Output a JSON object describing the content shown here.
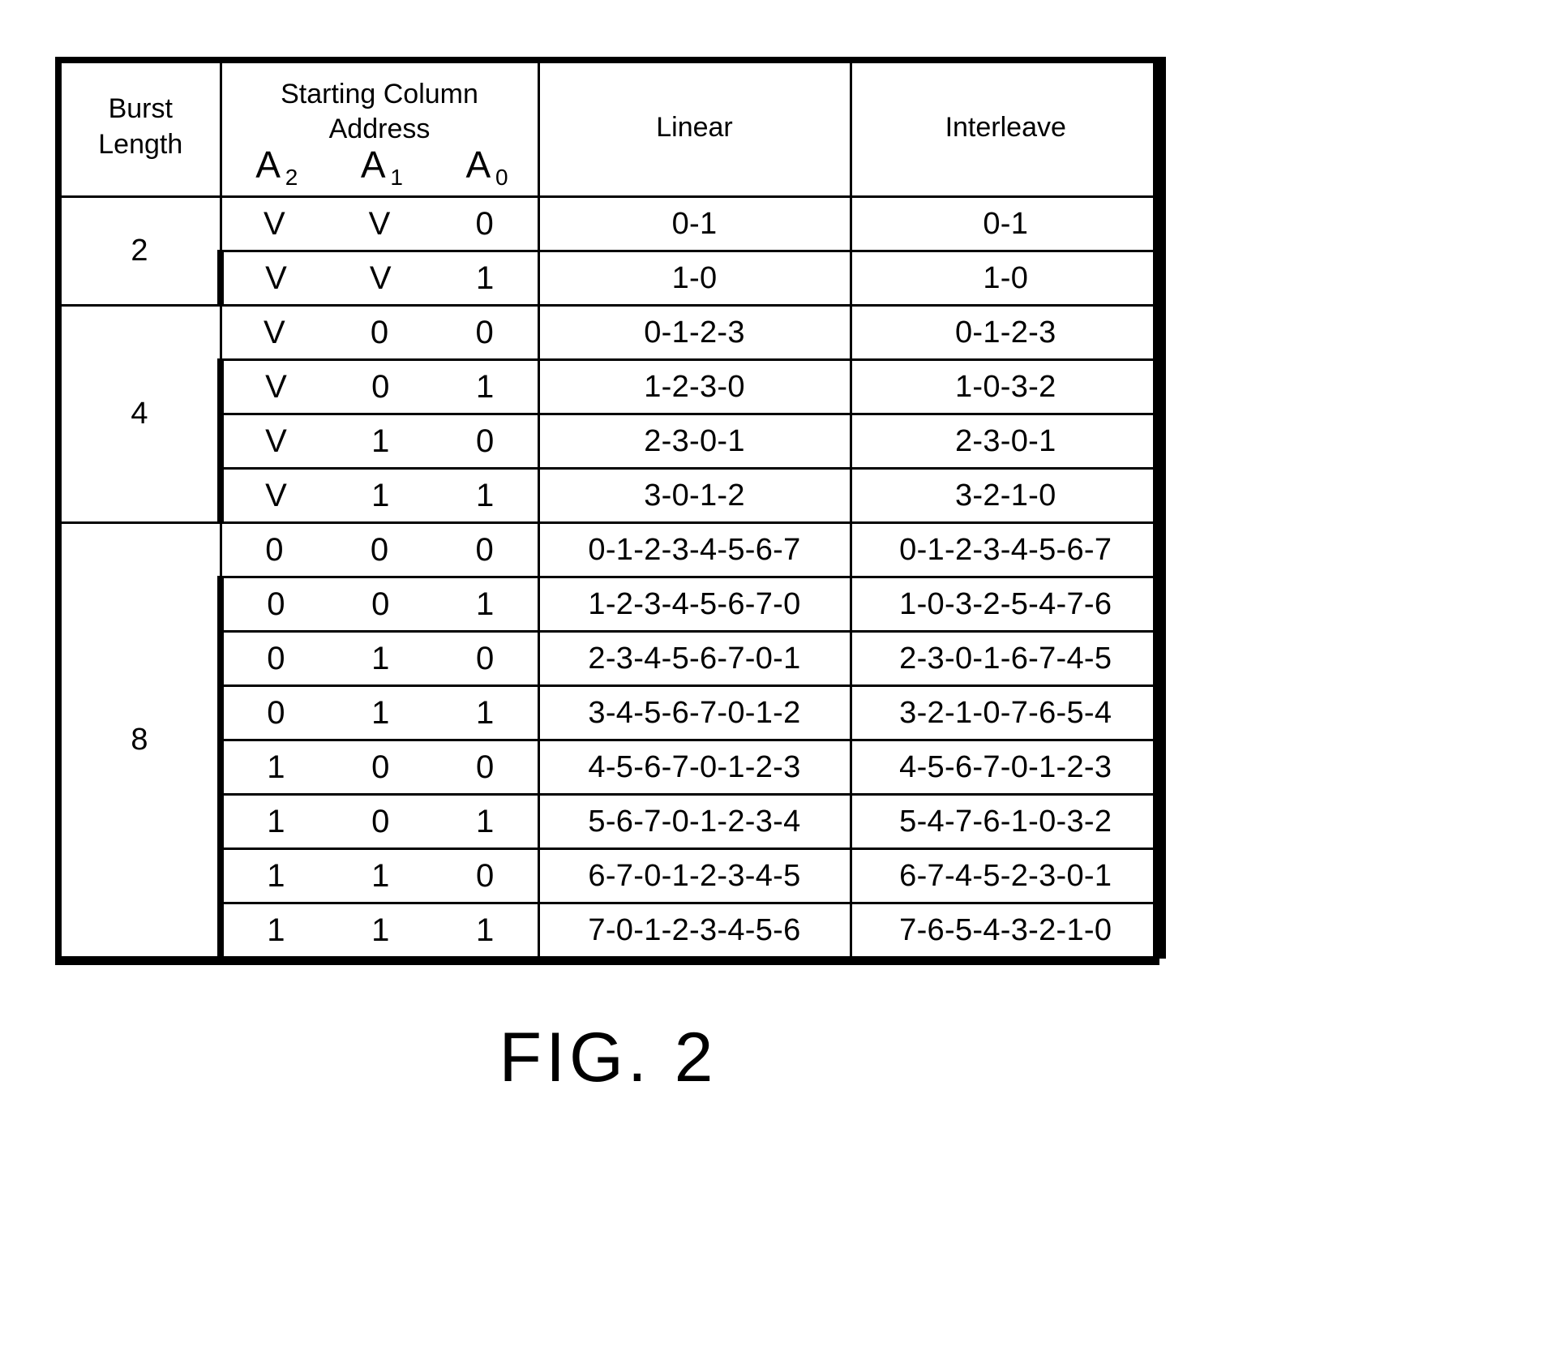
{
  "figure": {
    "caption": "FIG. 2"
  },
  "table": {
    "headers": {
      "burst_length_line1": "Burst",
      "burst_length_line2": "Length",
      "address_line1": "Starting Column",
      "address_line2": "Address",
      "bit_a2": "A",
      "bit_a2_sub": "2",
      "bit_a1": "A",
      "bit_a1_sub": "1",
      "bit_a0": "A",
      "bit_a0_sub": "0",
      "linear": "Linear",
      "interleave": "Interleave"
    },
    "dont_care_symbol": "V",
    "groups": [
      {
        "burst_length": "2",
        "rows": [
          {
            "a2": "V",
            "a1": "V",
            "a0": "0",
            "linear": "0-1",
            "interleave": "0-1"
          },
          {
            "a2": "V",
            "a1": "V",
            "a0": "1",
            "linear": "1-0",
            "interleave": "1-0"
          }
        ]
      },
      {
        "burst_length": "4",
        "rows": [
          {
            "a2": "V",
            "a1": "0",
            "a0": "0",
            "linear": "0-1-2-3",
            "interleave": "0-1-2-3"
          },
          {
            "a2": "V",
            "a1": "0",
            "a0": "1",
            "linear": "1-2-3-0",
            "interleave": "1-0-3-2"
          },
          {
            "a2": "V",
            "a1": "1",
            "a0": "0",
            "linear": "2-3-0-1",
            "interleave": "2-3-0-1"
          },
          {
            "a2": "V",
            "a1": "1",
            "a0": "1",
            "linear": "3-0-1-2",
            "interleave": "3-2-1-0"
          }
        ]
      },
      {
        "burst_length": "8",
        "rows": [
          {
            "a2": "0",
            "a1": "0",
            "a0": "0",
            "linear": "0-1-2-3-4-5-6-7",
            "interleave": "0-1-2-3-4-5-6-7"
          },
          {
            "a2": "0",
            "a1": "0",
            "a0": "1",
            "linear": "1-2-3-4-5-6-7-0",
            "interleave": "1-0-3-2-5-4-7-6"
          },
          {
            "a2": "0",
            "a1": "1",
            "a0": "0",
            "linear": "2-3-4-5-6-7-0-1",
            "interleave": "2-3-0-1-6-7-4-5"
          },
          {
            "a2": "0",
            "a1": "1",
            "a0": "1",
            "linear": "3-4-5-6-7-0-1-2",
            "interleave": "3-2-1-0-7-6-5-4"
          },
          {
            "a2": "1",
            "a1": "0",
            "a0": "0",
            "linear": "4-5-6-7-0-1-2-3",
            "interleave": "4-5-6-7-0-1-2-3"
          },
          {
            "a2": "1",
            "a1": "0",
            "a0": "1",
            "linear": "5-6-7-0-1-2-3-4",
            "interleave": "5-4-7-6-1-0-3-2"
          },
          {
            "a2": "1",
            "a1": "1",
            "a0": "0",
            "linear": "6-7-0-1-2-3-4-5",
            "interleave": "6-7-4-5-2-3-0-1"
          },
          {
            "a2": "1",
            "a1": "1",
            "a0": "1",
            "linear": "7-0-1-2-3-4-5-6",
            "interleave": "7-6-5-4-3-2-1-0"
          }
        ]
      }
    ]
  }
}
